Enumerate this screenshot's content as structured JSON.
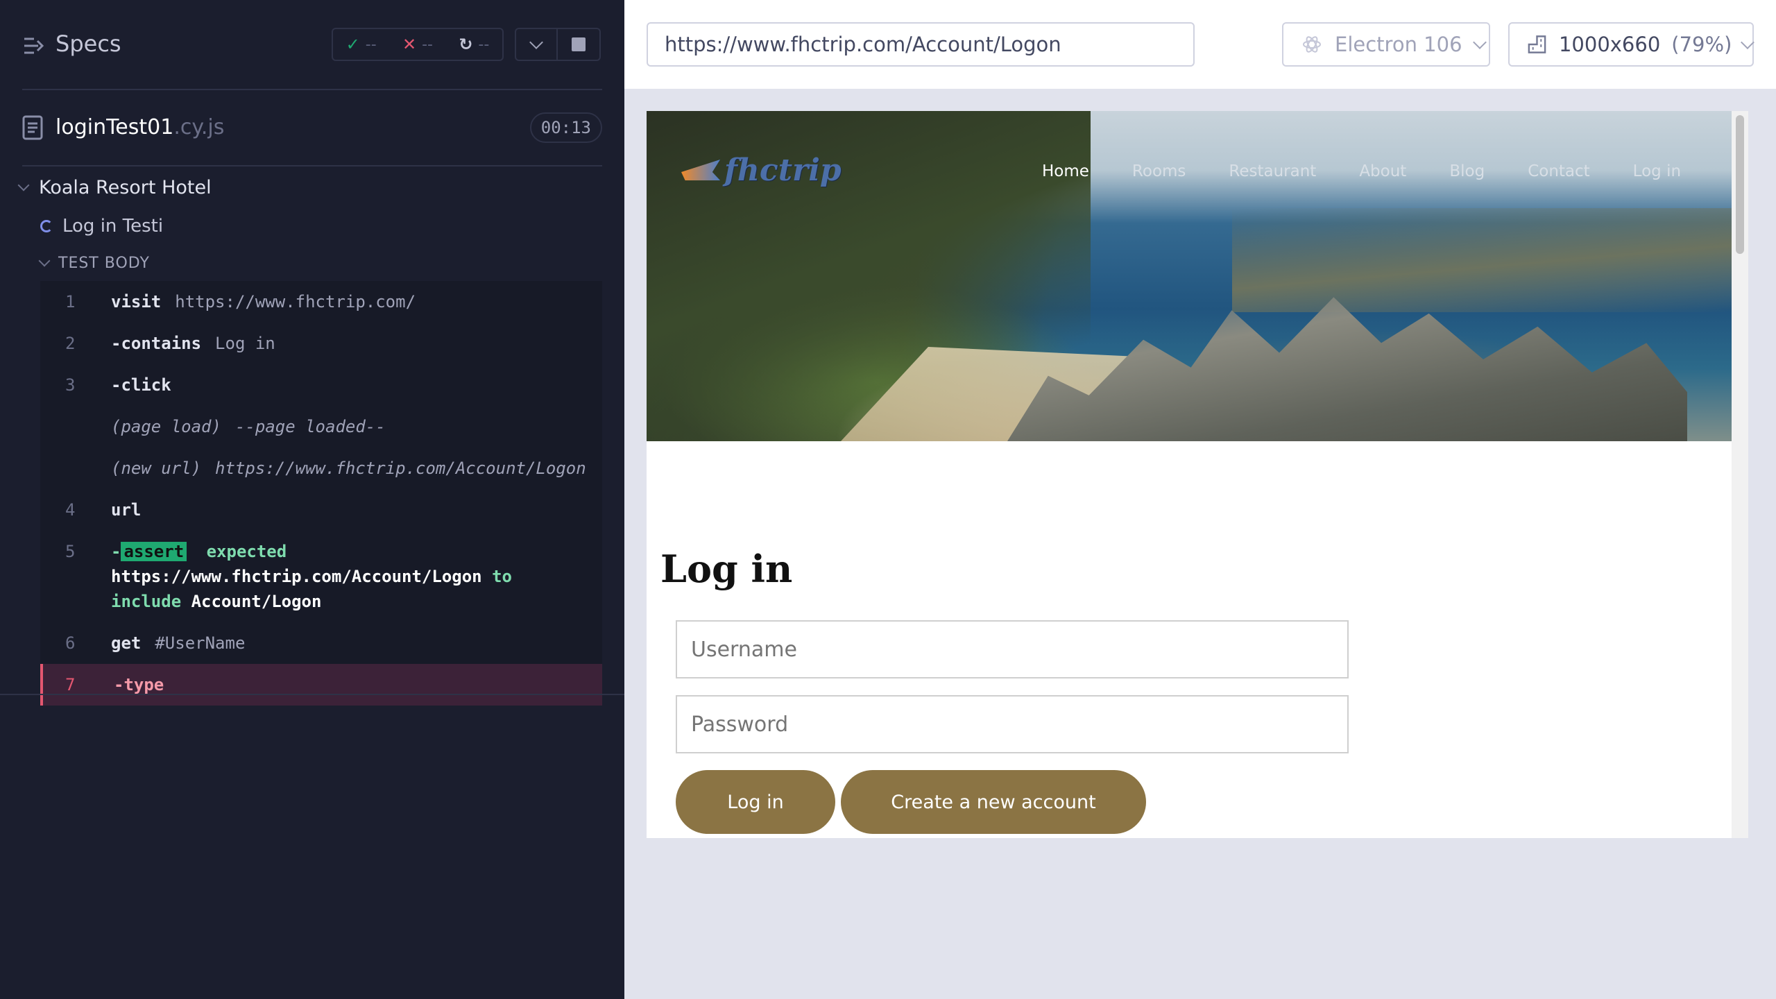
{
  "reporter": {
    "title": "Specs",
    "stats": {
      "passed": "--",
      "failed": "--",
      "pending": "--"
    },
    "spec": {
      "name": "loginTest01",
      "ext": ".cy.js",
      "duration": "00:13"
    },
    "suite": "Koala Resort Hotel",
    "test": "Log in Testi",
    "section": "TEST BODY",
    "commands": [
      {
        "num": "1",
        "name": "visit",
        "message": "https://www.fhctrip.com/"
      },
      {
        "num": "2",
        "prefix": "-",
        "name": "contains",
        "message": "Log in"
      },
      {
        "num": "3",
        "prefix": "-",
        "name": "click",
        "message": ""
      },
      {
        "event": "(page load)",
        "message": "--page loaded--"
      },
      {
        "event": "(new url)",
        "message": "https://www.fhctrip.com/Account/Logon"
      },
      {
        "num": "4",
        "name": "url",
        "message": ""
      },
      {
        "num": "5",
        "prefix": "-",
        "name": "assert",
        "expected": "expected",
        "actual": "https://www.fhctrip.com/Account/Logon",
        "to": "to",
        "include": "include",
        "target": "Account/Logon"
      },
      {
        "num": "6",
        "name": "get",
        "message": "#UserName"
      },
      {
        "num": "7",
        "prefix": "-",
        "name": "type",
        "message": ""
      }
    ]
  },
  "toolbar": {
    "url": "https://www.fhctrip.com/Account/Logon",
    "browser": "Electron 106",
    "viewport": "1000x660",
    "zoom": "(79%)"
  },
  "site": {
    "logo": "fhctrip",
    "nav": [
      "Home",
      "Rooms",
      "Restaurant",
      "About",
      "Blog",
      "Contact",
      "Log in"
    ],
    "heading": "Log in",
    "username_placeholder": "Username",
    "password_placeholder": "Password",
    "login_button": "Log in",
    "create_button": "Create a new account"
  },
  "colors": {
    "reporter_bg": "#1b1e2e",
    "pass": "#1fa971",
    "fail": "#e45770",
    "button_brown": "#8b7444"
  }
}
